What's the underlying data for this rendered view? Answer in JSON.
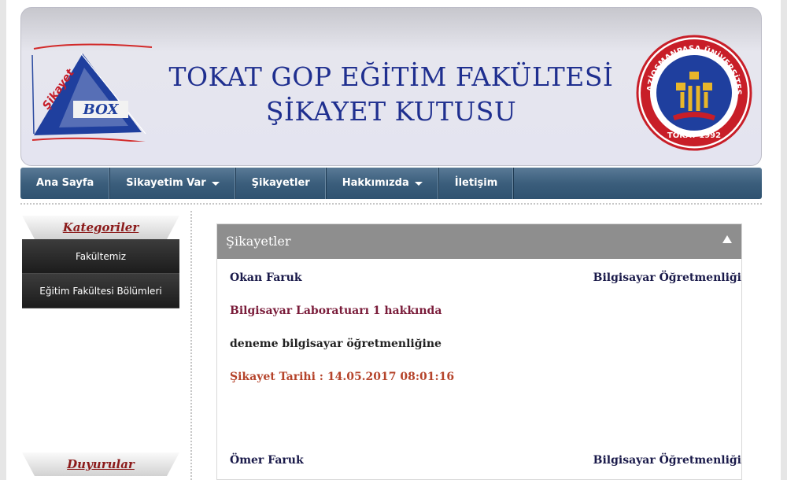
{
  "header": {
    "title_line1": "TOKAT GOP EĞİTİM FAKÜLTESİ",
    "title_line2": "ŞİKAYET KUTUSU",
    "left_logo": {
      "text_top": "Şikayet",
      "text_box": "BOX"
    },
    "seal": {
      "text_arc": "GAZİOSMANPAŞA ÜNİVERSİTESİ",
      "text_bottom": "TOKAT 1992"
    }
  },
  "nav": {
    "items": [
      {
        "label": "Ana Sayfa",
        "dropdown": false
      },
      {
        "label": "Sikayetim Var",
        "dropdown": true
      },
      {
        "label": "Şikayetler",
        "dropdown": false
      },
      {
        "label": "Hakkımızda",
        "dropdown": true
      },
      {
        "label": "İletişim",
        "dropdown": false
      }
    ]
  },
  "sidebar": {
    "kategoriler_title": "Kategoriler",
    "items": [
      {
        "label": "Fakültemiz"
      },
      {
        "label": "Eğitim Fakültesi Bölümleri"
      }
    ],
    "duyurular_title": "Duyurular"
  },
  "panel": {
    "title": "Şikayetler",
    "entries": [
      {
        "name": "Okan  Faruk",
        "department": "Bilgisayar Öğretmenliği",
        "subject": "Bilgisayar Laboratuarı 1 hakkında",
        "text": "deneme bilgisayar öğretmenliğine",
        "date": "Şikayet Tarihi : 14.05.2017 08:01:16"
      },
      {
        "name": "Ömer  Faruk",
        "department": "Bilgisayar Öğretmenliği"
      }
    ]
  },
  "colors": {
    "title_blue": "#1f2f8f",
    "nav_blue": "#3b5e7c",
    "panel_head": "#8e8e8e",
    "subject_red": "#7a1c3a",
    "date_orange": "#b5432a",
    "sidebar_title": "#8b1a1a"
  }
}
